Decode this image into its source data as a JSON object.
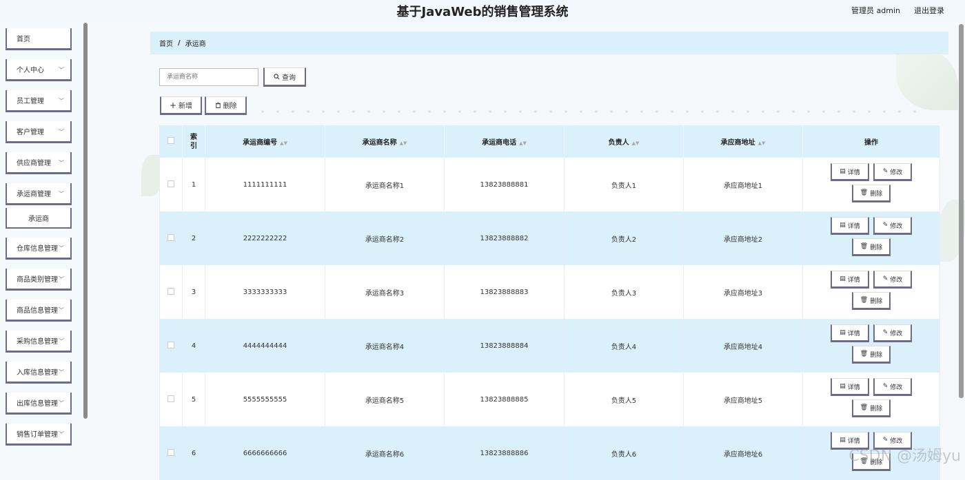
{
  "header": {
    "title": "基于JavaWeb的销售管理系统",
    "user": "管理员 admin",
    "logout": "退出登录"
  },
  "sidebar": {
    "items": [
      {
        "label": "首页",
        "has_chevron": false
      },
      {
        "label": "个人中心",
        "has_chevron": true
      },
      {
        "label": "员工管理",
        "has_chevron": true
      },
      {
        "label": "客户管理",
        "has_chevron": true
      },
      {
        "label": "供应商管理",
        "has_chevron": true
      },
      {
        "label": "承运商管理",
        "has_chevron": true
      },
      {
        "label": "仓库信息管理",
        "has_chevron": true
      },
      {
        "label": "商品类别管理",
        "has_chevron": true
      },
      {
        "label": "商品信息管理",
        "has_chevron": true
      },
      {
        "label": "采购信息管理",
        "has_chevron": true
      },
      {
        "label": "入库信息管理",
        "has_chevron": true
      },
      {
        "label": "出库信息管理",
        "has_chevron": true
      },
      {
        "label": "销售订单管理",
        "has_chevron": true
      }
    ],
    "sub_item": "承运商"
  },
  "breadcrumb": {
    "home": "首页",
    "current": "承运商"
  },
  "search": {
    "placeholder": "承运商名称",
    "button": "查询"
  },
  "toolbar": {
    "add": "新增",
    "delete": "删除"
  },
  "table": {
    "headers": [
      "索引",
      "承运商编号",
      "承运商名称",
      "承运商电话",
      "负责人",
      "承应商地址",
      "操作"
    ],
    "rows": [
      {
        "index": "1",
        "code": "1111111111",
        "name": "承运商名称1",
        "phone": "13823888881",
        "manager": "负责人1",
        "address": "承应商地址1"
      },
      {
        "index": "2",
        "code": "2222222222",
        "name": "承运商名称2",
        "phone": "13823888882",
        "manager": "负责人2",
        "address": "承应商地址2"
      },
      {
        "index": "3",
        "code": "3333333333",
        "name": "承运商名称3",
        "phone": "13823888883",
        "manager": "负责人3",
        "address": "承应商地址3"
      },
      {
        "index": "4",
        "code": "4444444444",
        "name": "承运商名称4",
        "phone": "13823888884",
        "manager": "负责人4",
        "address": "承应商地址4"
      },
      {
        "index": "5",
        "code": "5555555555",
        "name": "承运商名称5",
        "phone": "13823888885",
        "manager": "负责人5",
        "address": "承应商地址5"
      },
      {
        "index": "6",
        "code": "6666666666",
        "name": "承运商名称6",
        "phone": "13823888886",
        "manager": "负责人6",
        "address": "承应商地址6"
      }
    ],
    "actions": {
      "detail": "详情",
      "edit": "修改",
      "delete": "删除"
    }
  },
  "watermark": "CSDN @汤姆yu",
  "colors": {
    "accent": "#daf1fc",
    "button_border": "#6d6a8c"
  },
  "icons": {
    "search": "search-icon",
    "add": "plus-icon",
    "delete": "trash-icon",
    "detail": "document-icon",
    "edit": "pencil-icon",
    "chevron": "chevron-down-icon"
  }
}
